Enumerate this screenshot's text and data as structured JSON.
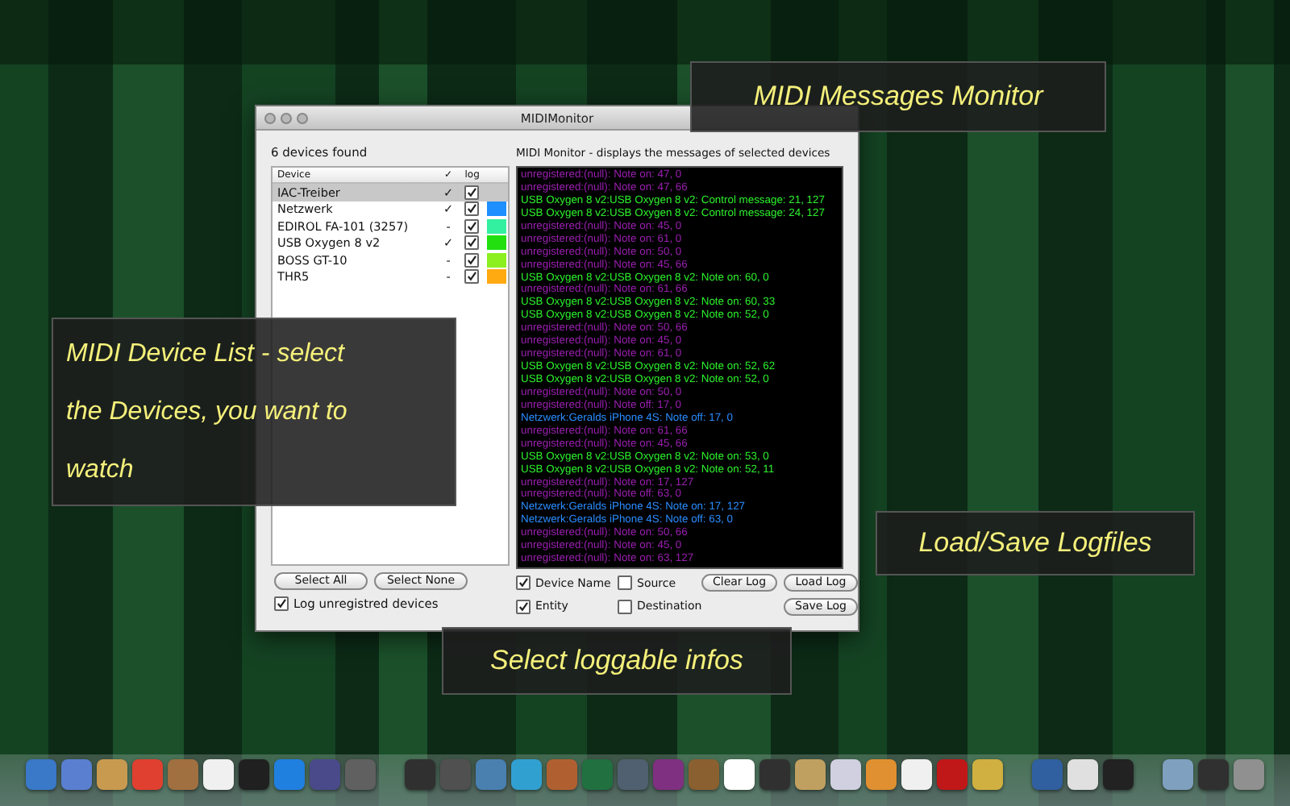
{
  "window": {
    "title": "MIDIMonitor",
    "device_panel": {
      "count_label": "6  devices found",
      "columns": [
        "Device",
        "✓",
        "log"
      ],
      "devices": [
        {
          "name": "IAC-Treiber",
          "mark": "✓",
          "log": true,
          "selected": true
        },
        {
          "name": "Netzwerk",
          "mark": "✓",
          "log": true,
          "selected": false,
          "color": "#1e8fff"
        },
        {
          "name": "EDIROL FA-101 (3257)",
          "mark": "-",
          "log": true,
          "selected": false,
          "color": "#33f0a0"
        },
        {
          "name": "USB Oxygen 8 v2",
          "mark": "✓",
          "log": true,
          "selected": false,
          "color": "#22e010"
        },
        {
          "name": "BOSS GT-10",
          "mark": "-",
          "log": true,
          "selected": false,
          "color": "#8cf020"
        },
        {
          "name": "THR5",
          "mark": "-",
          "log": true,
          "selected": false,
          "color": "#ffaa10"
        }
      ],
      "buttons": [
        "Select All",
        "Select None"
      ],
      "log_unregistered": {
        "label": "Log unregistred devices",
        "checked": true
      }
    },
    "monitor": {
      "header": "MIDI Monitor - displays the messages of selected devices",
      "lines": [
        {
          "text": "unregistered:(null): Note on: 47, 0",
          "color": "#9a1fb0"
        },
        {
          "text": "unregistered:(null): Note on: 47, 66",
          "color": "#9a1fb0"
        },
        {
          "text": "USB Oxygen 8 v2:USB Oxygen 8 v2: Control message: 21, 127",
          "color": "#2cf02c"
        },
        {
          "text": "USB Oxygen 8 v2:USB Oxygen 8 v2: Control message: 24, 127",
          "color": "#2cf02c"
        },
        {
          "text": "unregistered:(null): Note on: 45, 0",
          "color": "#9a1fb0"
        },
        {
          "text": "unregistered:(null): Note on: 61, 0",
          "color": "#9a1fb0"
        },
        {
          "text": "unregistered:(null): Note on: 50, 0",
          "color": "#9a1fb0"
        },
        {
          "text": "unregistered:(null): Note on: 45, 66",
          "color": "#9a1fb0"
        },
        {
          "text": "USB Oxygen 8 v2:USB Oxygen 8 v2: Note on: 60, 0",
          "color": "#2cf02c"
        },
        {
          "text": "unregistered:(null): Note on: 61, 66",
          "color": "#9a1fb0"
        },
        {
          "text": "USB Oxygen 8 v2:USB Oxygen 8 v2: Note on: 60, 33",
          "color": "#2cf02c"
        },
        {
          "text": "USB Oxygen 8 v2:USB Oxygen 8 v2: Note on: 52, 0",
          "color": "#2cf02c"
        },
        {
          "text": "unregistered:(null): Note on: 50, 66",
          "color": "#9a1fb0"
        },
        {
          "text": "unregistered:(null): Note on: 45, 0",
          "color": "#9a1fb0"
        },
        {
          "text": "unregistered:(null): Note on: 61, 0",
          "color": "#9a1fb0"
        },
        {
          "text": "USB Oxygen 8 v2:USB Oxygen 8 v2: Note on: 52, 62",
          "color": "#2cf02c"
        },
        {
          "text": "USB Oxygen 8 v2:USB Oxygen 8 v2: Note on: 52, 0",
          "color": "#2cf02c"
        },
        {
          "text": "unregistered:(null): Note on: 50, 0",
          "color": "#9a1fb0"
        },
        {
          "text": "unregistered:(null): Note off: 17, 0",
          "color": "#9a1fb0"
        },
        {
          "text": "Netzwerk:Geralds iPhone 4S: Note off: 17, 0",
          "color": "#2a8cff"
        },
        {
          "text": "unregistered:(null): Note on: 61, 66",
          "color": "#9a1fb0"
        },
        {
          "text": "unregistered:(null): Note on: 45, 66",
          "color": "#9a1fb0"
        },
        {
          "text": "USB Oxygen 8 v2:USB Oxygen 8 v2: Note on: 53, 0",
          "color": "#2cf02c"
        },
        {
          "text": "USB Oxygen 8 v2:USB Oxygen 8 v2: Note on: 52, 11",
          "color": "#2cf02c"
        },
        {
          "text": "unregistered:(null): Note on: 17, 127",
          "color": "#9a1fb0"
        },
        {
          "text": "unregistered:(null): Note off: 63, 0",
          "color": "#9a1fb0"
        },
        {
          "text": "Netzwerk:Geralds iPhone 4S: Note on: 17, 127",
          "color": "#2a8cff"
        },
        {
          "text": "Netzwerk:Geralds iPhone 4S: Note off: 63, 0",
          "color": "#2a8cff"
        },
        {
          "text": "unregistered:(null): Note on: 50, 66",
          "color": "#9a1fb0"
        },
        {
          "text": "unregistered:(null): Note on: 45, 0",
          "color": "#9a1fb0"
        },
        {
          "text": "unregistered:(null): Note on: 63, 127",
          "color": "#9a1fb0"
        }
      ],
      "options": [
        {
          "label": "Device Name",
          "checked": true
        },
        {
          "label": "Source",
          "checked": false
        },
        {
          "label": "Entity",
          "checked": true
        },
        {
          "label": "Destination",
          "checked": false
        }
      ],
      "buttons": [
        "Clear Log",
        "Load Log",
        "Save Log"
      ]
    }
  },
  "callouts": [
    {
      "text": "MIDI Messages Monitor"
    },
    {
      "text": "MIDI Device List - select the Devices, you want to watch"
    },
    {
      "text": "Load/Save Logfiles"
    },
    {
      "text": "Select loggable infos"
    }
  ]
}
